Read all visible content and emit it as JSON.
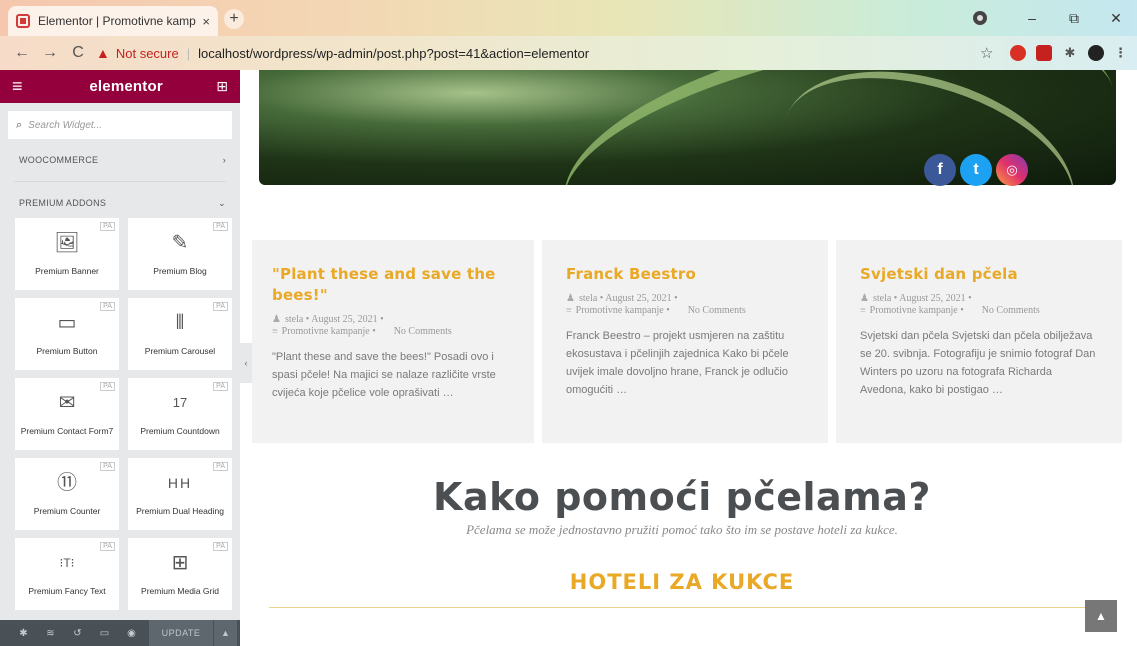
{
  "browser": {
    "tab_title": "Elementor | Promotivne kampanj",
    "tab_close": "×",
    "new_tab": "+",
    "window": {
      "minimize": "–",
      "maximize": "⧉",
      "close": "✕"
    },
    "nav": {
      "back": "←",
      "forward": "→",
      "reload": "C"
    },
    "not_secure": "Not secure",
    "separator": "|",
    "url": "localhost/wordpress/wp-admin/post.php?post=41&action=elementor",
    "star": "☆"
  },
  "elementor": {
    "logo": "elementor",
    "search_placeholder": "Search Widget...",
    "categories": {
      "woocommerce": "WOOCOMMERCE",
      "woocommerce_chevron": "›",
      "premium_addons": "PREMIUM ADDONS",
      "premium_chevron": "⌄"
    },
    "badge": "PA",
    "widgets": [
      {
        "label": "Premium Banner",
        "icon": "🖼",
        "icon_name": "image-icon"
      },
      {
        "label": "Premium Blog",
        "icon": "✎",
        "icon_name": "edit-icon"
      },
      {
        "label": "Premium Button",
        "icon": "▭",
        "icon_name": "button-icon"
      },
      {
        "label": "Premium Carousel",
        "icon": "⫴",
        "icon_name": "carousel-icon"
      },
      {
        "label": "Premium Contact Form7",
        "icon": "✉",
        "icon_name": "envelope-icon"
      },
      {
        "label": "Premium Countdown",
        "icon": "17",
        "icon_name": "calendar-icon"
      },
      {
        "label": "Premium Counter",
        "icon": "⑪",
        "icon_name": "counter-icon"
      },
      {
        "label": "Premium Dual Heading",
        "icon": "HH",
        "icon_name": "dual-heading-icon"
      },
      {
        "label": "Premium Fancy Text",
        "icon": "⁝T⁝",
        "icon_name": "fancy-text-icon"
      },
      {
        "label": "Premium Media Grid",
        "icon": "⊞",
        "icon_name": "grid-icon"
      }
    ],
    "footer": {
      "update_label": "UPDATE",
      "update_arrow": "▲"
    },
    "collapse": "‹"
  },
  "page": {
    "social": {
      "facebook": "f",
      "twitter": "t",
      "instagram": "◎"
    },
    "posts": [
      {
        "title": "\"Plant these and save the bees!\"",
        "author": "stela",
        "date": "August 25, 2021",
        "category": "Promotivne kampanje",
        "comments": "No Comments",
        "excerpt": "\"Plant these and save the bees!\" Posadi ovo i spasi pčele! Na majici se nalaze različite vrste cvijeća koje pčelice vole oprašivati …"
      },
      {
        "title": "Franck Beestro",
        "author": "stela",
        "date": "August 25, 2021",
        "category": "Promotivne kampanje",
        "comments": "No Comments",
        "excerpt": "Franck Beestro – projekt usmjeren na zaštitu ekosustava i pčelinjih zajednica Kako bi pčele uvijek imale dovoljno hrane, Franck je odlučio omogućiti …"
      },
      {
        "title": "Svjetski dan pčela",
        "author": "stela",
        "date": "August 25, 2021",
        "category": "Promotivne kampanje",
        "comments": "No Comments",
        "excerpt": "Svjetski dan pčela Svjetski dan pčela obilježava se 20. svibnja. Fotografiju je snimio fotograf Dan Winters po uzoru na fotografa Richarda Avedona, kako bi postigao …"
      }
    ],
    "meta_sep": "•",
    "headline": "Kako pomoći pčelama?",
    "subline": "Pčelama se može jednostavno pružiti pomoć tako što im se postave hoteli za kukce.",
    "section_heading": "HOTELI ZA KUKCE",
    "scroll_top": "▲"
  },
  "colors": {
    "elementor_header": "#93003c",
    "accent": "#e9a825",
    "footer": "#495157"
  }
}
